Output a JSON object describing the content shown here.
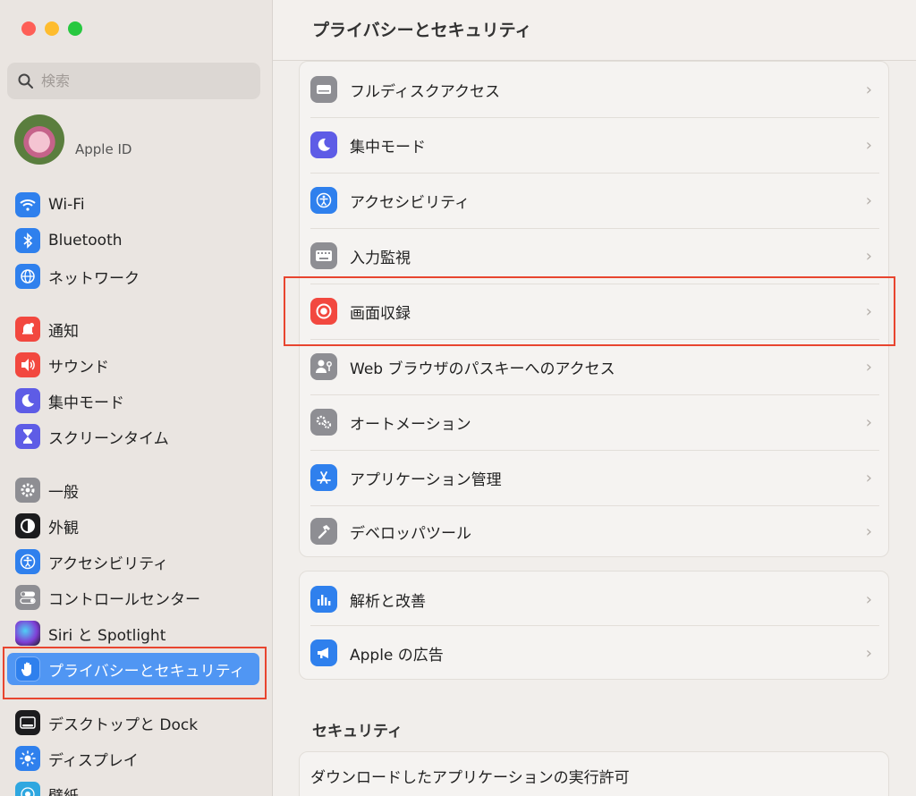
{
  "sidebar": {
    "search_placeholder": "検索",
    "apple_id": "Apple ID",
    "items": [
      {
        "label": "Wi-Fi",
        "icon": "wifi-icon",
        "color": "#2f80ed"
      },
      {
        "label": "Bluetooth",
        "icon": "bluetooth-icon",
        "color": "#2f80ed"
      },
      {
        "label": "ネットワーク",
        "icon": "globe-icon",
        "color": "#2f80ed"
      },
      {
        "label": "通知",
        "icon": "bell-icon",
        "color": "#f2483f"
      },
      {
        "label": "サウンド",
        "icon": "speaker-icon",
        "color": "#f2483f"
      },
      {
        "label": "集中モード",
        "icon": "moon-icon",
        "color": "#5e5ce6"
      },
      {
        "label": "スクリーンタイム",
        "icon": "hourglass-icon",
        "color": "#5e5ce6"
      },
      {
        "label": "一般",
        "icon": "gear-icon",
        "color": "#8e8e93"
      },
      {
        "label": "外観",
        "icon": "appearance-icon",
        "color": "#1c1c1e"
      },
      {
        "label": "アクセシビリティ",
        "icon": "accessibility-icon",
        "color": "#2f80ed"
      },
      {
        "label": "コントロールセンター",
        "icon": "toggles-icon",
        "color": "#8e8e93"
      },
      {
        "label": "Siri と Spotlight",
        "icon": "siri-icon",
        "color": "#6b3fa0"
      },
      {
        "label": "プライバシーとセキュリティ",
        "icon": "hand-icon",
        "color": "#2f80ed"
      },
      {
        "label": "デスクトップと Dock",
        "icon": "dock-icon",
        "color": "#1c1c1e"
      },
      {
        "label": "ディスプレイ",
        "icon": "sun-icon",
        "color": "#2f80ed"
      },
      {
        "label": "壁紙",
        "icon": "wallpaper-icon",
        "color": "#2fa7e0"
      }
    ],
    "active": "プライバシーとセキュリティ"
  },
  "main": {
    "title": "プライバシーとセキュリティ",
    "group1": [
      {
        "label": "フルディスクアクセス",
        "icon": "disk-icon",
        "color": "#8e8e93"
      },
      {
        "label": "集中モード",
        "icon": "moon-icon",
        "color": "#5e5ce6"
      },
      {
        "label": "アクセシビリティ",
        "icon": "accessibility-icon",
        "color": "#2f80ed"
      },
      {
        "label": "入力監視",
        "icon": "keyboard-icon",
        "color": "#8e8e93"
      },
      {
        "label": "画面収録",
        "icon": "record-icon",
        "color": "#f2483f"
      },
      {
        "label": "Web ブラウザのパスキーへのアクセス",
        "icon": "person-key-icon",
        "color": "#8e8e93"
      },
      {
        "label": "オートメーション",
        "icon": "gears-icon",
        "color": "#8e8e93"
      },
      {
        "label": "アプリケーション管理",
        "icon": "appstore-icon",
        "color": "#2f80ed"
      },
      {
        "label": "デベロッパツール",
        "icon": "hammer-icon",
        "color": "#8e8e93"
      }
    ],
    "group2": [
      {
        "label": "解析と改善",
        "icon": "chart-icon",
        "color": "#2f80ed"
      },
      {
        "label": "Apple の広告",
        "icon": "megaphone-icon",
        "color": "#2f80ed"
      }
    ],
    "security_header": "セキュリティ",
    "security_row": "ダウンロードしたアプリケーションの実行許可"
  }
}
